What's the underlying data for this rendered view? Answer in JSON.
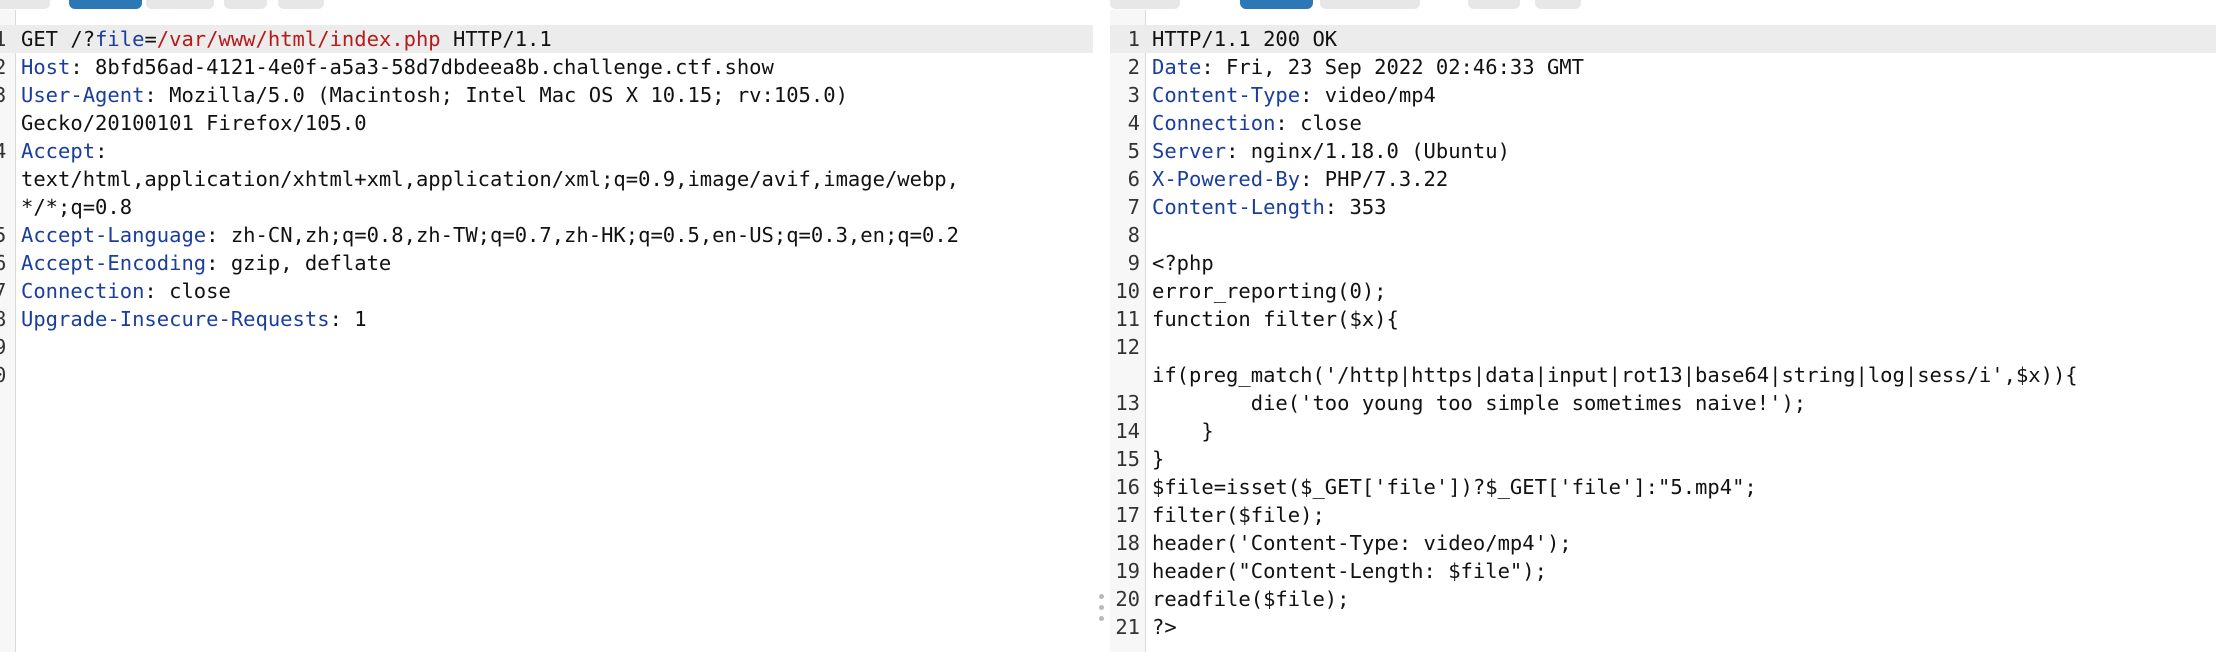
{
  "colors": {
    "header_name": "#1b3e9c",
    "url_value": "#b61a1a",
    "active_tab": "#2c78b7",
    "highlight": "#ececec"
  },
  "request": {
    "lines": [
      {
        "n": "1",
        "method": "GET /?",
        "param": "file",
        "eq": "=",
        "value": "/var/www/html/index.php",
        "proto": " HTTP/1.1"
      },
      {
        "n": "2",
        "k": "Host",
        "v": ": 8bfd56ad-4121-4e0f-a5a3-58d7dbdeea8b.challenge.ctf.show"
      },
      {
        "n": "3",
        "k": "User-Agent",
        "v": ": Mozilla/5.0 (Macintosh; Intel Mac OS X 10.15; rv:105.0)"
      },
      {
        "n": "",
        "t": "Gecko/20100101 Firefox/105.0"
      },
      {
        "n": "4",
        "k": "Accept",
        "v": ":"
      },
      {
        "n": "",
        "t": "text/html,application/xhtml+xml,application/xml;q=0.9,image/avif,image/webp,"
      },
      {
        "n": "",
        "t": "*/*;q=0.8"
      },
      {
        "n": "5",
        "k": "Accept-Language",
        "v": ": zh-CN,zh;q=0.8,zh-TW;q=0.7,zh-HK;q=0.5,en-US;q=0.3,en;q=0.2"
      },
      {
        "n": "6",
        "k": "Accept-Encoding",
        "v": ": gzip, deflate"
      },
      {
        "n": "7",
        "k": "Connection",
        "v": ": close"
      },
      {
        "n": "8",
        "k": "Upgrade-Insecure-Requests",
        "v": ": 1"
      },
      {
        "n": "9",
        "t": ""
      },
      {
        "n": "0",
        "t": ""
      }
    ]
  },
  "response": {
    "lines": [
      {
        "n": "1",
        "t": "HTTP/1.1 200 OK"
      },
      {
        "n": "2",
        "k": "Date",
        "v": ": Fri, 23 Sep 2022 02:46:33 GMT"
      },
      {
        "n": "3",
        "k": "Content-Type",
        "v": ": video/mp4"
      },
      {
        "n": "4",
        "k": "Connection",
        "v": ": close"
      },
      {
        "n": "5",
        "k": "Server",
        "v": ": nginx/1.18.0 (Ubuntu)"
      },
      {
        "n": "6",
        "k": "X-Powered-By",
        "v": ": PHP/7.3.22"
      },
      {
        "n": "7",
        "k": "Content-Length",
        "v": ": 353"
      },
      {
        "n": "8",
        "t": ""
      },
      {
        "n": "9",
        "t": "<?php"
      },
      {
        "n": "10",
        "t": "error_reporting(0);"
      },
      {
        "n": "11",
        "t": "function filter($x){"
      },
      {
        "n": "12",
        "t": ""
      },
      {
        "n": "",
        "t": "if(preg_match('/http|https|data|input|rot13|base64|string|log|sess/i',$x)){"
      },
      {
        "n": "13",
        "t": "        die('too young too simple sometimes naive!');"
      },
      {
        "n": "14",
        "t": "    }"
      },
      {
        "n": "15",
        "t": "}"
      },
      {
        "n": "16",
        "t": "$file=isset($_GET['file'])?$_GET['file']:\"5.mp4\";"
      },
      {
        "n": "17",
        "t": "filter($file);"
      },
      {
        "n": "18",
        "t": "header('Content-Type: video/mp4');"
      },
      {
        "n": "19",
        "t": "header(\"Content-Length: $file\");"
      },
      {
        "n": "20",
        "t": "readfile($file);"
      },
      {
        "n": "21",
        "t": "?>"
      }
    ]
  }
}
